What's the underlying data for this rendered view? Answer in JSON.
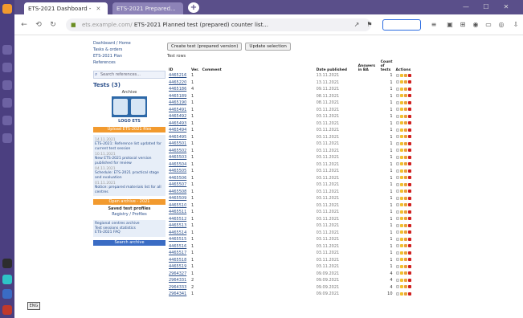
{
  "browser": {
    "tabs": [
      {
        "label": "ETS-2021 Dashboard - ",
        "state": "active"
      },
      {
        "label": "ETS-2021 Prepared...",
        "state": "inactive"
      }
    ],
    "url_host": "ets.example.com/",
    "url_path": "ETS-2021 Planned test (prepared) counter list..."
  },
  "sidebar": {
    "links": [
      "Dashboard / Home",
      "Tasks & orders",
      "ETS-2021 Plan",
      "References"
    ],
    "search_placeholder": "Search references...",
    "title": "Tests (3)",
    "logo_caption": "Archive",
    "logo_label": "LOGO ETS",
    "orange_button": "Upload ETS-2021 files",
    "news": [
      {
        "date": "14.11.2021",
        "text": "ETS-2021: Reference list updated for current test session"
      },
      {
        "date": "10.11.2021",
        "text": "New ETS-2021 protocol version published for review"
      },
      {
        "date": "04.11.2021",
        "text": "Schedule: ETS-2021 practical stage and evaluation"
      },
      {
        "date": "01.11.2021",
        "text": "Notice: prepared materials list for all centres"
      }
    ],
    "orange_button2": "Open archive - 2021",
    "section": "Saved test profiles",
    "section_sub": "Registry / Profiles",
    "foot_links": [
      "Regional centres archive",
      "Test sessions statistics",
      "ETS-2021 FAQ"
    ],
    "blue_button": "Search archive"
  },
  "main": {
    "buttons": [
      "Create test (prepared version)",
      "Update selection"
    ],
    "count_label": "Test rows",
    "columns": {
      "id": "ID",
      "ver": "Ver.",
      "label": "Comment",
      "date": "Date published",
      "ba": "Answers in BA",
      "cnt": "Count of tests",
      "act": "Actions"
    },
    "rows": [
      {
        "id": "4465216",
        "ver": "1",
        "date": "13.11.2021",
        "cnt": "1"
      },
      {
        "id": "4465220",
        "ver": "1",
        "date": "13.11.2021",
        "cnt": "1"
      },
      {
        "id": "4465186",
        "ver": "4",
        "date": "09.11.2021",
        "cnt": "1"
      },
      {
        "id": "4465189",
        "ver": "1",
        "date": "08.11.2021",
        "cnt": "1"
      },
      {
        "id": "4465190",
        "ver": "1",
        "date": "08.11.2021",
        "cnt": "1"
      },
      {
        "id": "4465491",
        "ver": "1",
        "date": "03.11.2021",
        "cnt": "1"
      },
      {
        "id": "4465492",
        "ver": "1",
        "date": "03.11.2021",
        "cnt": "1"
      },
      {
        "id": "4465493",
        "ver": "1",
        "date": "03.11.2021",
        "cnt": "1"
      },
      {
        "id": "4465494",
        "ver": "1",
        "date": "03.11.2021",
        "cnt": "1"
      },
      {
        "id": "4465495",
        "ver": "1",
        "date": "03.11.2021",
        "cnt": "1"
      },
      {
        "id": "4465501",
        "ver": "1",
        "date": "03.11.2021",
        "cnt": "1"
      },
      {
        "id": "4465502",
        "ver": "1",
        "date": "03.11.2021",
        "cnt": "1"
      },
      {
        "id": "4465503",
        "ver": "1",
        "date": "03.11.2021",
        "cnt": "1"
      },
      {
        "id": "4465504",
        "ver": "1",
        "date": "03.11.2021",
        "cnt": "1"
      },
      {
        "id": "4465505",
        "ver": "1",
        "date": "03.11.2021",
        "cnt": "1"
      },
      {
        "id": "4465506",
        "ver": "1",
        "date": "03.11.2021",
        "cnt": "1"
      },
      {
        "id": "4465507",
        "ver": "1",
        "date": "03.11.2021",
        "cnt": "1"
      },
      {
        "id": "4465508",
        "ver": "1",
        "date": "03.11.2021",
        "cnt": "1"
      },
      {
        "id": "4465509",
        "ver": "1",
        "date": "03.11.2021",
        "cnt": "1"
      },
      {
        "id": "4465510",
        "ver": "1",
        "date": "03.11.2021",
        "cnt": "1"
      },
      {
        "id": "4465511",
        "ver": "1",
        "date": "03.11.2021",
        "cnt": "1"
      },
      {
        "id": "4465512",
        "ver": "1",
        "date": "03.11.2021",
        "cnt": "1"
      },
      {
        "id": "4465513",
        "ver": "1",
        "date": "03.11.2021",
        "cnt": "1"
      },
      {
        "id": "4465514",
        "ver": "1",
        "date": "03.11.2021",
        "cnt": "1"
      },
      {
        "id": "4465515",
        "ver": "1",
        "date": "03.11.2021",
        "cnt": "1"
      },
      {
        "id": "4465516",
        "ver": "1",
        "date": "03.11.2021",
        "cnt": "1"
      },
      {
        "id": "4465517",
        "ver": "1",
        "date": "03.11.2021",
        "cnt": "1"
      },
      {
        "id": "4465518",
        "ver": "1",
        "date": "03.11.2021",
        "cnt": "1"
      },
      {
        "id": "4465519",
        "ver": "1",
        "date": "03.11.2021",
        "cnt": "1"
      },
      {
        "id": "2964327",
        "ver": "1",
        "date": "09.09.2021",
        "cnt": "4"
      },
      {
        "id": "2964331",
        "ver": "2",
        "date": "09.09.2021",
        "cnt": "4"
      },
      {
        "id": "2964333",
        "ver": "2",
        "date": "09.09.2021",
        "cnt": "4"
      },
      {
        "id": "2964341",
        "ver": "1",
        "date": "09.09.2021",
        "cnt": "10"
      }
    ]
  },
  "taskbar": {
    "button": "ENG"
  }
}
